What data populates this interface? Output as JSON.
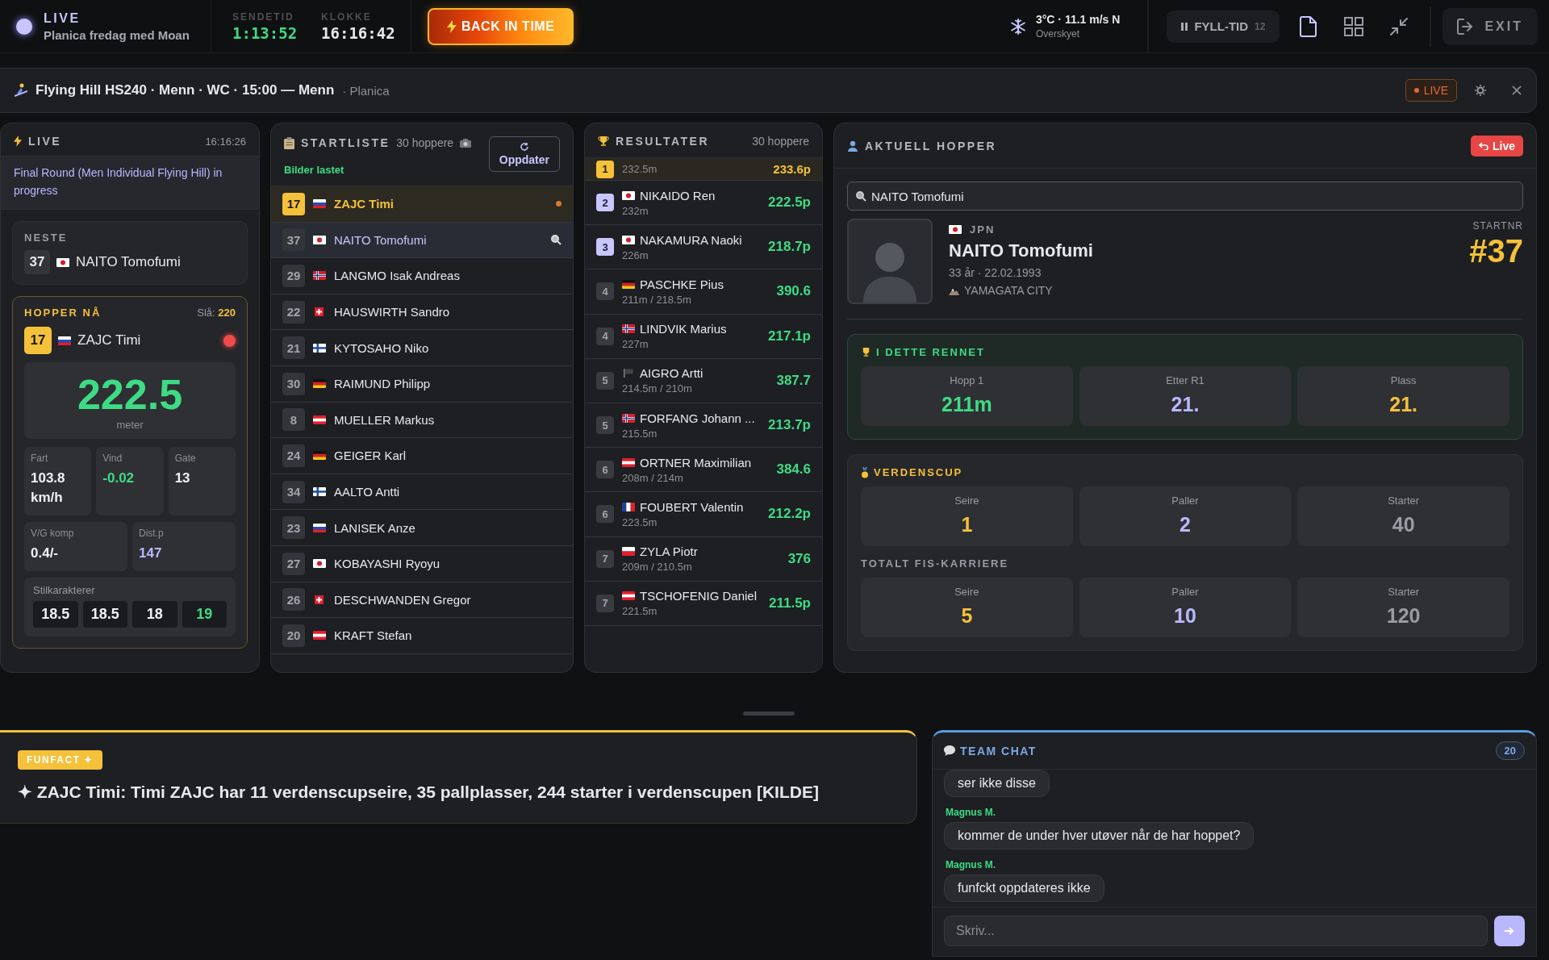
{
  "topbar": {
    "live_label": "LIVE",
    "show_name": "Planica fredag med Moan",
    "broadcast_time": {
      "label": "SENDETID",
      "value": "1:13:52"
    },
    "clock": {
      "label": "KLOKKE",
      "value": "16:16:42"
    },
    "back_button": "BACK IN TIME",
    "weather": {
      "reading": "3°C · 11.1 m/s N",
      "condition": "Overskyet"
    },
    "fill_button": {
      "label": "FYLL-TID",
      "count": "12"
    },
    "exit_button": "EXIT"
  },
  "event_bar": {
    "title": "Flying Hill HS240 · Menn · WC · 15:00 — Menn",
    "venue": "· Planica",
    "live_badge": "LIVE"
  },
  "live_panel": {
    "title": "LIVE",
    "time": "16:16:26",
    "status": "Final Round (Men Individual Flying Hill) in progress",
    "next": {
      "label": "NESTE",
      "bib": "37",
      "flag": {
        "kind": "jp"
      },
      "name": "NAITO Tomofumi"
    },
    "current": {
      "label": "HOPPER NÅ",
      "hill_label": "Slå:",
      "hill_value": "220",
      "bib": "17",
      "flag": {
        "kind": "si"
      },
      "name": "ZAJC Timi",
      "distance": "222.5",
      "unit": "meter",
      "stats": [
        {
          "label": "Fart",
          "value": "103.8 km/h",
          "color": "#f0f0f2"
        },
        {
          "label": "Vind",
          "value": "-0.02",
          "color": "#3ddc84"
        },
        {
          "label": "Gate",
          "value": "13",
          "color": "#f0f0f2"
        },
        {
          "label": "V/G komp",
          "value": "0.4/-",
          "color": "#f0f0f2"
        },
        {
          "label": "Dist.p",
          "value": "147",
          "color": "#b9b8ff"
        }
      ],
      "style_label": "Stilkarakterer",
      "style_marks": [
        {
          "value": "18.5",
          "highlighted": false
        },
        {
          "value": "18.5",
          "highlighted": false
        },
        {
          "value": "18",
          "highlighted": false
        },
        {
          "value": "19",
          "highlighted": true
        }
      ]
    }
  },
  "start_list": {
    "title": "STARTLISTE",
    "count": "30 hoppere",
    "status": "Bilder lastet",
    "refresh_button": "Oppdater",
    "rows": [
      {
        "bib": "17",
        "flag": {
          "kind": "si"
        },
        "name": "ZAJC Timi",
        "jumping": true,
        "selected": false
      },
      {
        "bib": "37",
        "flag": {
          "kind": "jp"
        },
        "name": "NAITO Tomofumi",
        "jumping": false,
        "selected": true
      },
      {
        "bib": "29",
        "flag": {
          "kind": "no"
        },
        "name": "LANGMO Isak Andreas",
        "jumping": false,
        "selected": false
      },
      {
        "bib": "22",
        "flag": {
          "kind": "ch"
        },
        "name": "HAUSWIRTH Sandro",
        "jumping": false,
        "selected": false
      },
      {
        "bib": "21",
        "flag": {
          "kind": "fi"
        },
        "name": "KYTOSAHO Niko",
        "jumping": false,
        "selected": false
      },
      {
        "bib": "30",
        "flag": {
          "kind": "de"
        },
        "name": "RAIMUND Philipp",
        "jumping": false,
        "selected": false
      },
      {
        "bib": "8",
        "flag": {
          "kind": "at"
        },
        "name": "MUELLER Markus",
        "jumping": false,
        "selected": false
      },
      {
        "bib": "24",
        "flag": {
          "kind": "de"
        },
        "name": "GEIGER Karl",
        "jumping": false,
        "selected": false
      },
      {
        "bib": "34",
        "flag": {
          "kind": "fi"
        },
        "name": "AALTO Antti",
        "jumping": false,
        "selected": false
      },
      {
        "bib": "23",
        "flag": {
          "kind": "si"
        },
        "name": "LANISEK Anze",
        "jumping": false,
        "selected": false
      },
      {
        "bib": "27",
        "flag": {
          "kind": "jp"
        },
        "name": "KOBAYASHI Ryoyu",
        "jumping": false,
        "selected": false
      },
      {
        "bib": "26",
        "flag": {
          "kind": "ch"
        },
        "name": "DESCHWANDEN Gregor",
        "jumping": false,
        "selected": false
      },
      {
        "bib": "20",
        "flag": {
          "kind": "at"
        },
        "name": "KRAFT Stefan",
        "jumping": false,
        "selected": false
      }
    ]
  },
  "results": {
    "title": "RESULTATER",
    "count": "30 hoppere",
    "rows": [
      {
        "rank": "1",
        "kind": "first",
        "detail": "232.5m",
        "points": "233.6p"
      },
      {
        "rank": "2",
        "kind": "podium",
        "flag": {
          "kind": "jp"
        },
        "name": "NIKAIDO Ren",
        "detail": "232m",
        "points": "222.5p"
      },
      {
        "rank": "3",
        "kind": "podium",
        "flag": {
          "kind": "jp"
        },
        "name": "NAKAMURA Naoki",
        "detail": "226m",
        "points": "218.7p"
      },
      {
        "rank": "4",
        "kind": "rest",
        "flag": {
          "kind": "de"
        },
        "name": "PASCHKE Pius",
        "detail": "211m / 218.5m",
        "points": "390.6"
      },
      {
        "rank": "4",
        "kind": "rest",
        "flag": {
          "kind": "no"
        },
        "name": "LINDVIK Marius",
        "detail": "227m",
        "points": "217.1p"
      },
      {
        "rank": "5",
        "kind": "rest",
        "flag": {
          "kind": "none"
        },
        "name": "AIGRO Artti",
        "detail": "214.5m / 210m",
        "points": "387.7"
      },
      {
        "rank": "5",
        "kind": "rest",
        "flag": {
          "kind": "no"
        },
        "name": "FORFANG Johann ...",
        "detail": "215.5m",
        "points": "213.7p"
      },
      {
        "rank": "6",
        "kind": "rest",
        "flag": {
          "kind": "at"
        },
        "name": "ORTNER Maximilian",
        "detail": "208m / 214m",
        "points": "384.6"
      },
      {
        "rank": "6",
        "kind": "rest",
        "flag": {
          "kind": "fr"
        },
        "name": "FOUBERT Valentin",
        "detail": "223.5m",
        "points": "212.2p"
      },
      {
        "rank": "7",
        "kind": "rest",
        "flag": {
          "kind": "pl"
        },
        "name": "ZYLA Piotr",
        "detail": "209m / 210.5m",
        "points": "376"
      },
      {
        "rank": "7",
        "kind": "rest",
        "flag": {
          "kind": "at"
        },
        "name": "TSCHOFENIG Daniel",
        "detail": "221.5m",
        "points": "211.5p"
      }
    ]
  },
  "athlete": {
    "title": "AKTUELL HOPPER",
    "live_button": "Live",
    "search_value": "NAITO Tomofumi",
    "flag": {
      "kind": "jp"
    },
    "country": "JPN",
    "name": "NAITO Tomofumi",
    "meta": "33 år · 22.02.1993",
    "club": "YAMAGATA CITY",
    "startnr_label": "STARTNR",
    "startnr": "#37",
    "race": {
      "title": "I DETTE RENNET",
      "stats": [
        {
          "label": "Hopp 1",
          "value": "211m",
          "color": "#3ddc84"
        },
        {
          "label": "Etter R1",
          "value": "21.",
          "color": "#b9b8ff"
        },
        {
          "label": "Plass",
          "value": "21.",
          "color": "#f5c13a"
        }
      ]
    },
    "world_cup": {
      "title": "VERDENSCUP",
      "stats": [
        {
          "label": "Seire",
          "value": "1",
          "color": "#f5c13a"
        },
        {
          "label": "Paller",
          "value": "2",
          "color": "#b9b8ff"
        },
        {
          "label": "Starter",
          "value": "40",
          "color": "#9a9ba3"
        }
      ]
    },
    "career": {
      "title": "TOTALT FIS-KARRIERE",
      "stats": [
        {
          "label": "Seire",
          "value": "5",
          "color": "#f5c13a"
        },
        {
          "label": "Paller",
          "value": "10",
          "color": "#b9b8ff"
        },
        {
          "label": "Starter",
          "value": "120",
          "color": "#9a9ba3"
        }
      ]
    }
  },
  "funfact": {
    "badge": "FUNFACT ✦",
    "text": "✦ ZAJC Timi: Timi ZAJC har 11 verdenscupseire, 35 pallplasser, 244 starter i verdenscupen [KILDE]"
  },
  "team_chat": {
    "title": "TEAM CHAT",
    "count": "20",
    "messages": [
      {
        "text": "ser ikke disse"
      },
      {
        "author": "Magnus M.",
        "text": "kommer de under hver utøver når de har hoppet?"
      },
      {
        "author": "Magnus M.",
        "text": "funfckt oppdateres ikke"
      }
    ],
    "input_placeholder": "Skriv..."
  }
}
